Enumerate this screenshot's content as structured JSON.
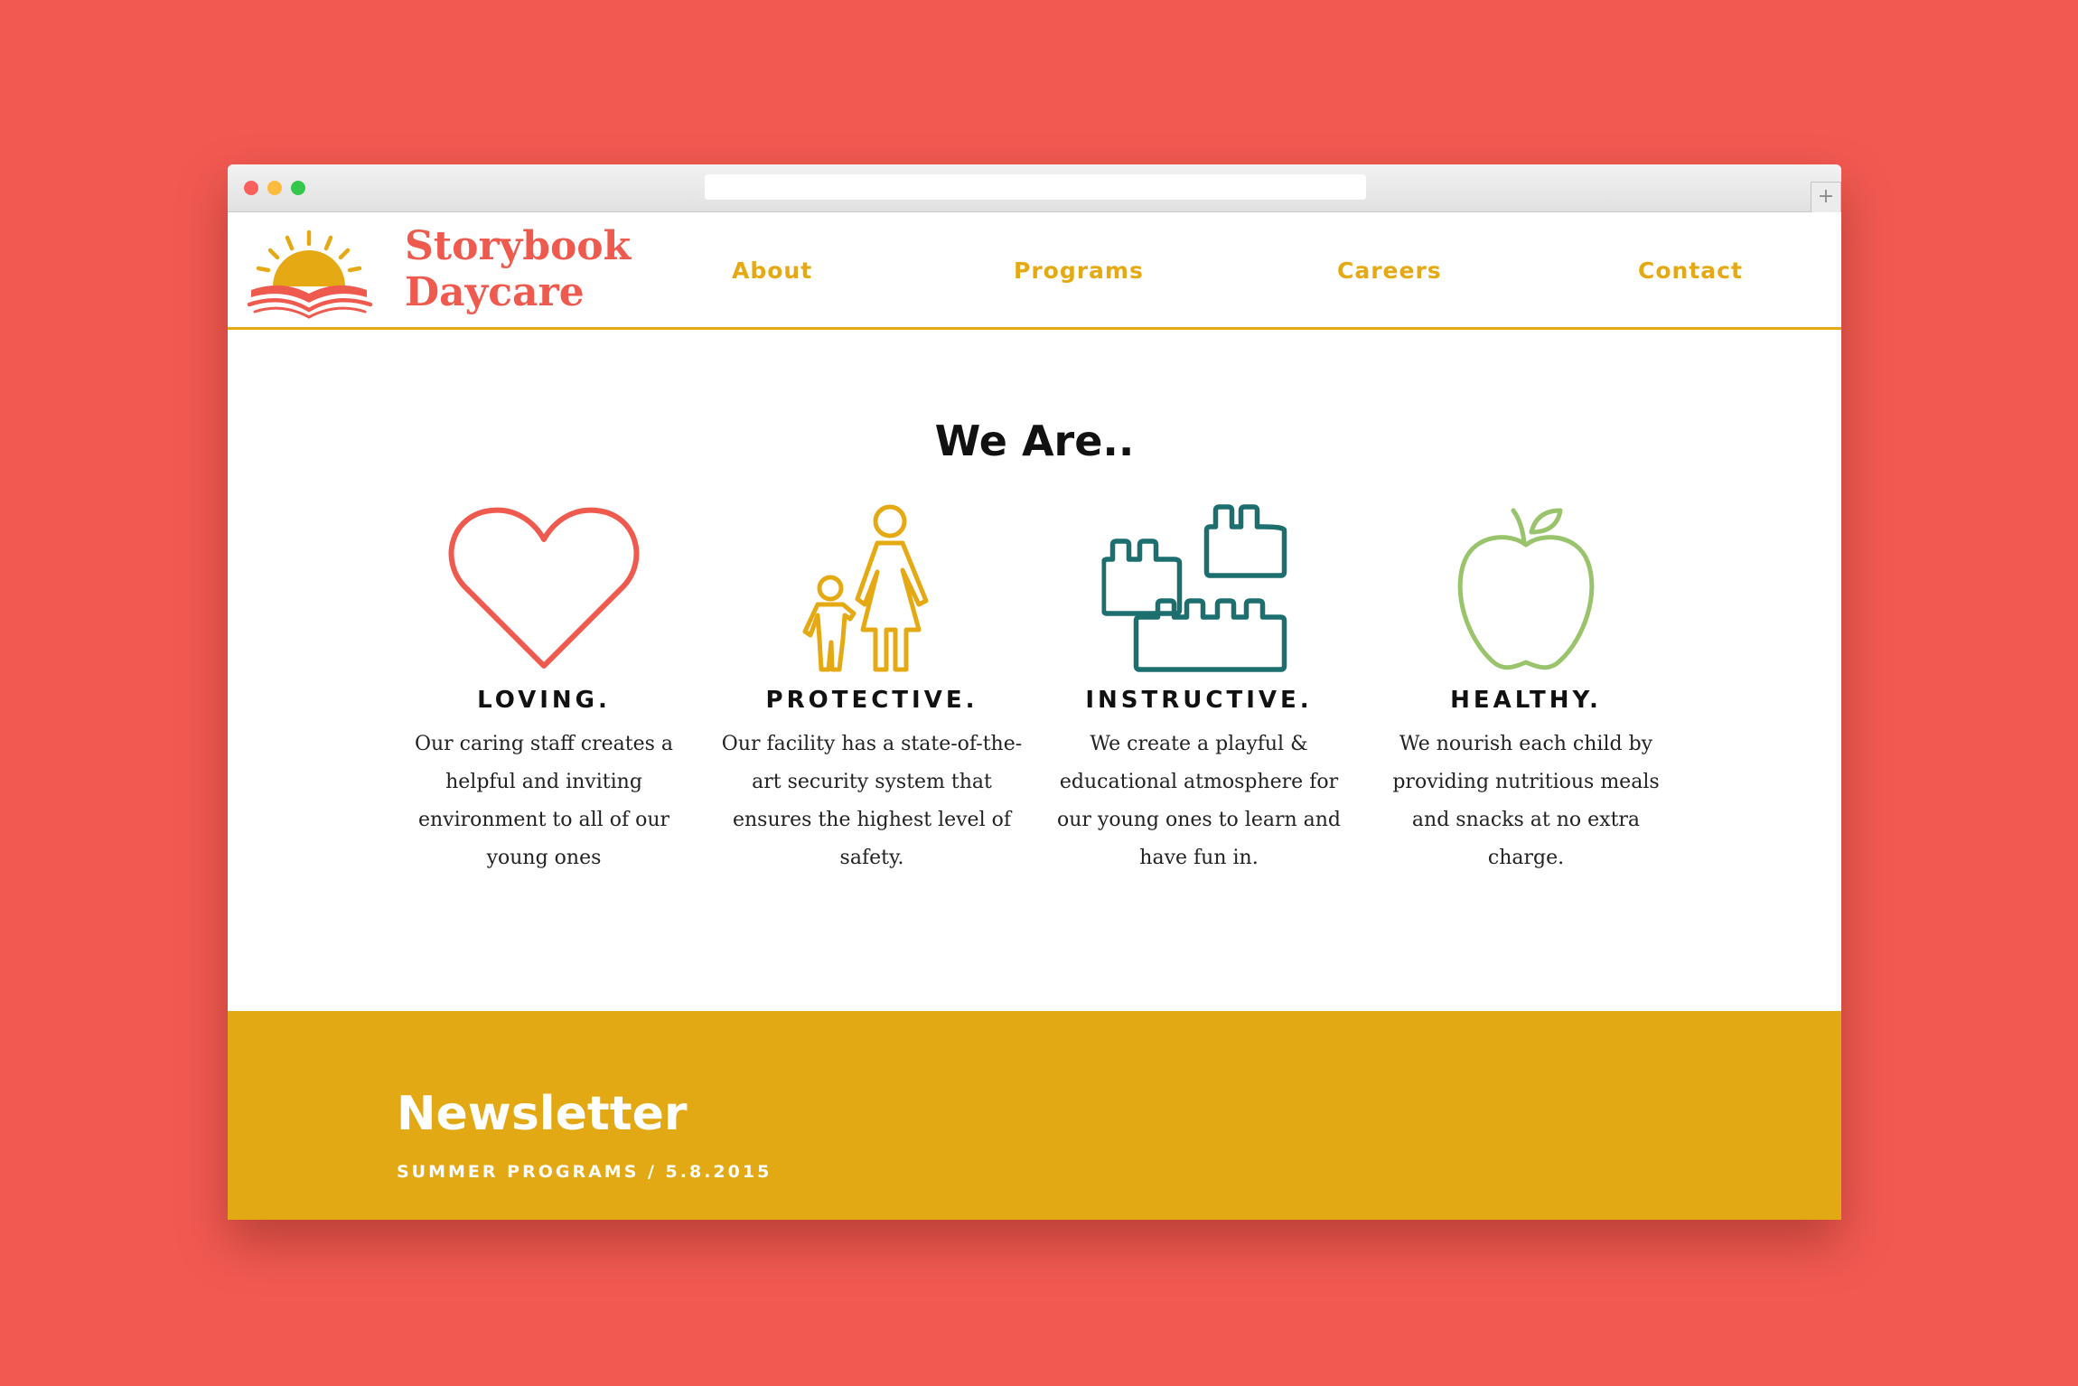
{
  "header": {
    "brand_line1": "Storybook",
    "brand_line2": "Daycare",
    "nav": [
      "About",
      "Programs",
      "Careers",
      "Contact"
    ]
  },
  "main": {
    "title": "We Are..",
    "features": [
      {
        "icon": "heart-icon",
        "heading": "LOVING.",
        "text": "Our caring staff creates a helpful and inviting environment to all of our young ones",
        "color": "#ef5a4f"
      },
      {
        "icon": "parent-child-icon",
        "heading": "PROTECTIVE.",
        "text": "Our facility has a state-of-the-art security system that ensures the highest level of safety.",
        "color": "#e5a914"
      },
      {
        "icon": "building-blocks-icon",
        "heading": "INSTRUCTIVE.",
        "text": "We create a playful & educational atmosphere for our young ones to learn and have fun in.",
        "color": "#1c6e6f"
      },
      {
        "icon": "apple-icon",
        "heading": "HEALTHY.",
        "text": "We nourish each child by providing nutritious meals and snacks at no extra charge.",
        "color": "#99c46c"
      }
    ]
  },
  "newsletter": {
    "title": "Newsletter",
    "meta": "SUMMER PROGRAMS / 5.8.2015"
  },
  "browser": {
    "new_tab_glyph": "+"
  },
  "colors": {
    "background": "#f25a51",
    "accent": "#e5a914",
    "brand": "#ef5a4f"
  }
}
